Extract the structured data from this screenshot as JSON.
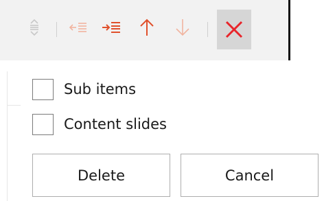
{
  "toolbar": {
    "buttons": [
      {
        "icon": "reorder-icon",
        "state": "disabled"
      },
      {
        "icon": "outdent-icon",
        "state": "enabled"
      },
      {
        "icon": "indent-icon",
        "state": "enabled"
      },
      {
        "icon": "move-up-icon",
        "state": "enabled"
      },
      {
        "icon": "move-down-icon",
        "state": "disabled"
      },
      {
        "icon": "close-icon",
        "state": "active"
      }
    ],
    "colors": {
      "accent": "#e0502b",
      "accent_light": "#f1b49f",
      "disabled": "#c8c8c8",
      "close": "#e8242a"
    }
  },
  "dialog": {
    "options": [
      {
        "label": "Sub items",
        "checked": false
      },
      {
        "label": "Content slides",
        "checked": false
      }
    ],
    "delete_label": "Delete",
    "cancel_label": "Cancel"
  }
}
